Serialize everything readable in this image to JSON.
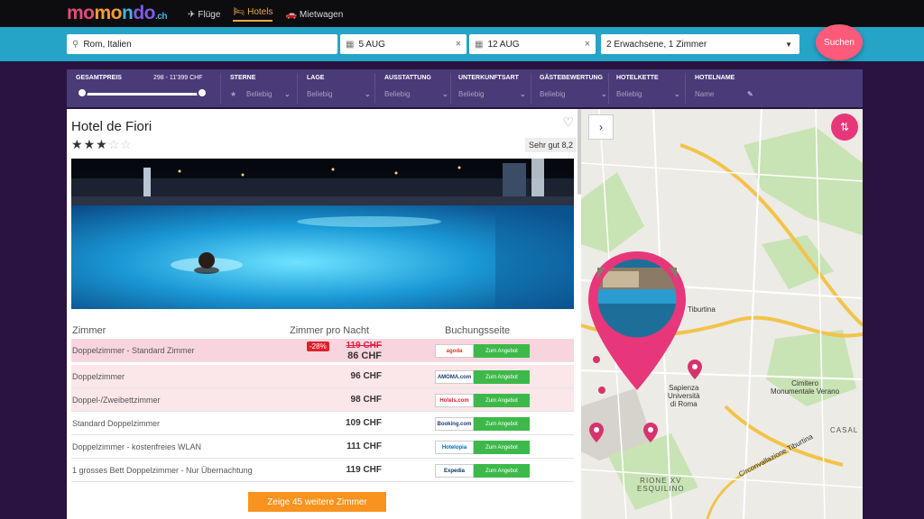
{
  "header": {
    "logo_main": "momondo",
    "logo_suffix": ".ch",
    "nav": [
      {
        "label": "Flüge",
        "icon": "plane-icon",
        "active": false
      },
      {
        "label": "Hotels",
        "icon": "bed-icon",
        "active": true
      },
      {
        "label": "Mietwagen",
        "icon": "car-icon",
        "active": false
      }
    ]
  },
  "search": {
    "destination": "Rom, Italien",
    "checkin": "5 AUG",
    "checkout": "12 AUG",
    "guests": "2 Erwachsene, 1 Zimmer",
    "button": "Suchen"
  },
  "filters": {
    "total_price_label": "GESAMTPREIS",
    "price_range": "298 - 11'399 CHF",
    "items": [
      {
        "label": "STERNE",
        "value": "Beliebig"
      },
      {
        "label": "LAGE",
        "value": "Beliebig"
      },
      {
        "label": "AUSSTATTUNG",
        "value": "Beliebig"
      },
      {
        "label": "UNTERKUNFTSART",
        "value": "Beliebig"
      },
      {
        "label": "GÄSTEBEWERTUNG",
        "value": "Beliebig"
      },
      {
        "label": "HOTELKETTE",
        "value": "Beliebig"
      },
      {
        "label": "HOTELNAME",
        "value": "Name"
      }
    ]
  },
  "hotel": {
    "name": "Hotel de Fiori",
    "stars": 3,
    "max_stars": 5,
    "rating": "Sehr gut 8,2",
    "table_headers": {
      "room": "Zimmer",
      "per_night": "Zimmer pro Nacht",
      "booking": "Buchungsseite"
    },
    "rooms": [
      {
        "name": "Doppelzimmer - Standard Zimmer",
        "old_price": "119 CHF",
        "price": "86 CHF",
        "discount": "-28%",
        "provider": "agoda",
        "deal": "Zum Angebot"
      },
      {
        "name": "Doppelzimmer",
        "price": "96 CHF",
        "provider": "AMOMA.com",
        "deal": "Zum Angebot"
      },
      {
        "name": "Doppel-/Zweibettzimmer",
        "price": "98 CHF",
        "provider": "Hotels.com",
        "deal": "Zum Angebot"
      },
      {
        "name": "Standard Doppelzimmer",
        "price": "109 CHF",
        "provider": "Booking.com",
        "deal": "Zum Angebot"
      },
      {
        "name": "Doppelzimmer - kostenfreies WLAN",
        "price": "111 CHF",
        "provider": "Hotelopia",
        "deal": "Zum Angebot"
      },
      {
        "name": "1 grosses Bett Doppelzimmer - Nur Übernachtung",
        "price": "119 CHF",
        "provider": "Expedia",
        "deal": "Zum Angebot"
      }
    ],
    "more_button": "Zeige 45 weitere Zimmer"
  },
  "map": {
    "labels": {
      "tiburtina": "Tiburtina",
      "sapienza": "Sapienza\nUniversità\ndi Roma",
      "cimitero": "Cimitero\nMonumentale Verano",
      "rione": "RIONE XV\nESQUILINO",
      "casal": "CASAL",
      "circ": "Circonvallazione Tiburtina"
    }
  }
}
